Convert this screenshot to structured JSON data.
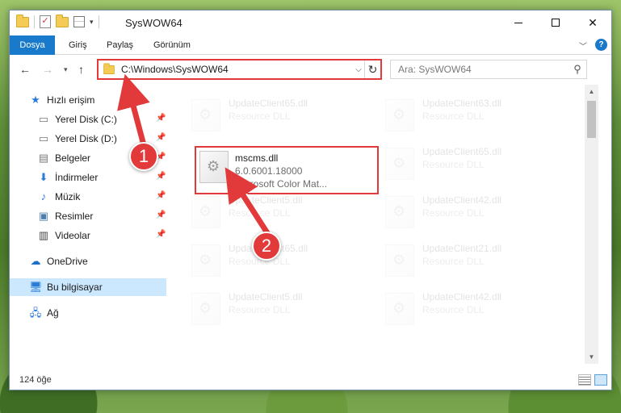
{
  "window": {
    "title": "SysWOW64"
  },
  "ribbon": {
    "tabs": [
      "Dosya",
      "Giriş",
      "Paylaş",
      "Görünüm"
    ],
    "help": "?"
  },
  "nav": {
    "address": "C:\\Windows\\SysWOW64",
    "search_placeholder": "Ara: SysWOW64"
  },
  "sidebar": {
    "items": [
      {
        "label": "Hızlı erişim",
        "icon": "star-icon"
      },
      {
        "label": "Yerel Disk (C:)",
        "icon": "drive-icon"
      },
      {
        "label": "Yerel Disk (D:)",
        "icon": "drive-icon"
      },
      {
        "label": "Belgeler",
        "icon": "documents-icon"
      },
      {
        "label": "İndirmeler",
        "icon": "downloads-icon"
      },
      {
        "label": "Müzik",
        "icon": "music-icon"
      },
      {
        "label": "Resimler",
        "icon": "pictures-icon"
      },
      {
        "label": "Videolar",
        "icon": "videos-icon"
      },
      {
        "label": "OneDrive",
        "icon": "cloud-icon"
      },
      {
        "label": "Bu bilgisayar",
        "icon": "computer-icon"
      },
      {
        "label": "Ağ",
        "icon": "network-icon"
      }
    ],
    "selected": "Bu bilgisayar"
  },
  "files": {
    "highlighted": {
      "name": "mscms.dll",
      "version": "6.0.6001.18000",
      "description": "Microsoft Color Mat..."
    },
    "background": [
      {
        "name": "UpdateClient65.dll",
        "type": "Resource DLL"
      },
      {
        "name": "UpdateClient63.dll",
        "type": "Resource DLL"
      },
      {
        "name": "UpdateClient65.dll",
        "type": "Resource DLL"
      },
      {
        "name": "UpdateClient5.dll",
        "type": "Resource DLL"
      },
      {
        "name": "UpdateClient42.dll",
        "type": "Resource DLL"
      },
      {
        "name": "UpdateClient65.dll",
        "type": "Resource DLL"
      },
      {
        "name": "UpdateClient21.dll",
        "type": "Resource DLL"
      },
      {
        "name": "UpdateClient5.dll",
        "type": "Resource DLL"
      },
      {
        "name": "UpdateClient42.dll",
        "type": "Resource DLL"
      }
    ]
  },
  "status": {
    "item_count": "124 öğe"
  },
  "annotations": {
    "step1": "1",
    "step2": "2",
    "color": "#e23a3a"
  }
}
